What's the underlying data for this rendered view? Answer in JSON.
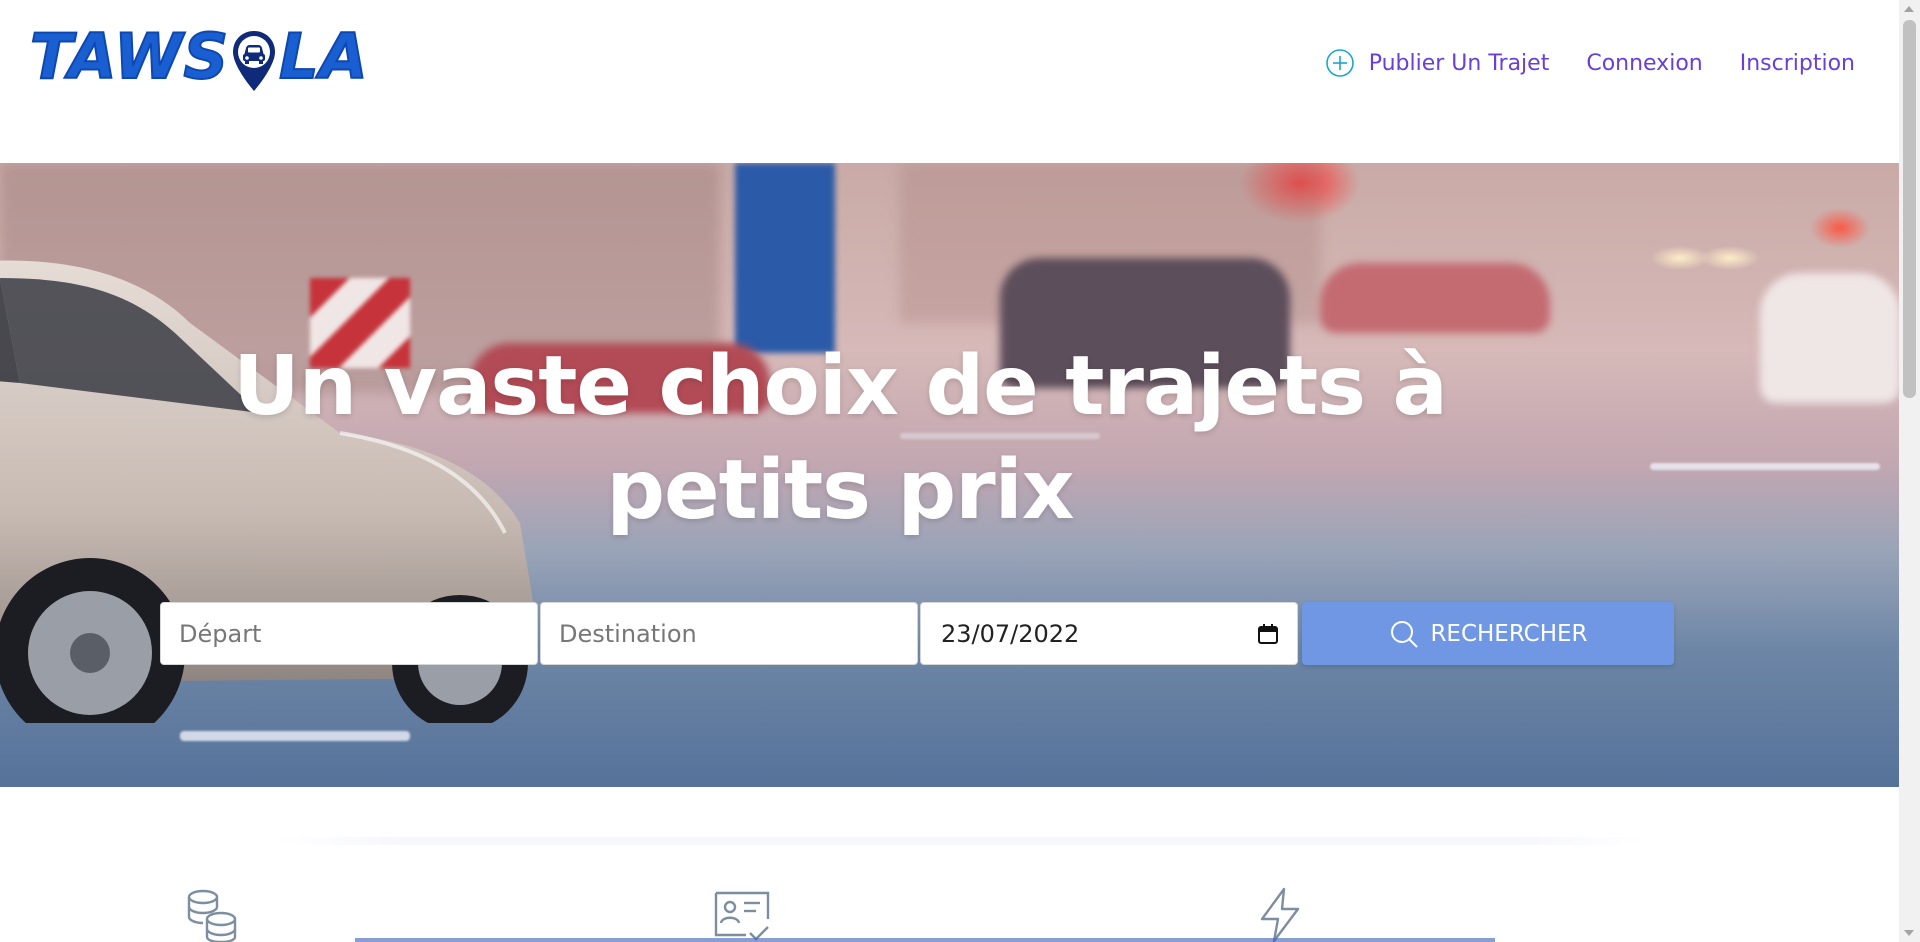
{
  "header": {
    "logo_text_left": "TAWS",
    "logo_text_right": "LA",
    "nav": [
      {
        "label": "Publier Un Trajet",
        "icon": "plus-circle-icon"
      },
      {
        "label": "Connexion"
      },
      {
        "label": "Inscription"
      }
    ]
  },
  "hero": {
    "title_line1": "Un vaste choix de trajets à",
    "title_line2": "petits prix"
  },
  "search": {
    "departure_placeholder": "Départ",
    "destination_placeholder": "Destination",
    "date_value": "23/07/2022",
    "button_label": "RECHERCHER"
  },
  "features": {
    "icons": [
      "coins-icon",
      "id-card-check-icon",
      "lightning-icon"
    ]
  },
  "colors": {
    "brand_blue": "#1a5fd1",
    "nav_purple": "#6a3fd8",
    "plus_icon_cyan": "#1aa7c9",
    "search_button": "#6f97e4",
    "feature_icon_gray": "#7d8ea0"
  }
}
